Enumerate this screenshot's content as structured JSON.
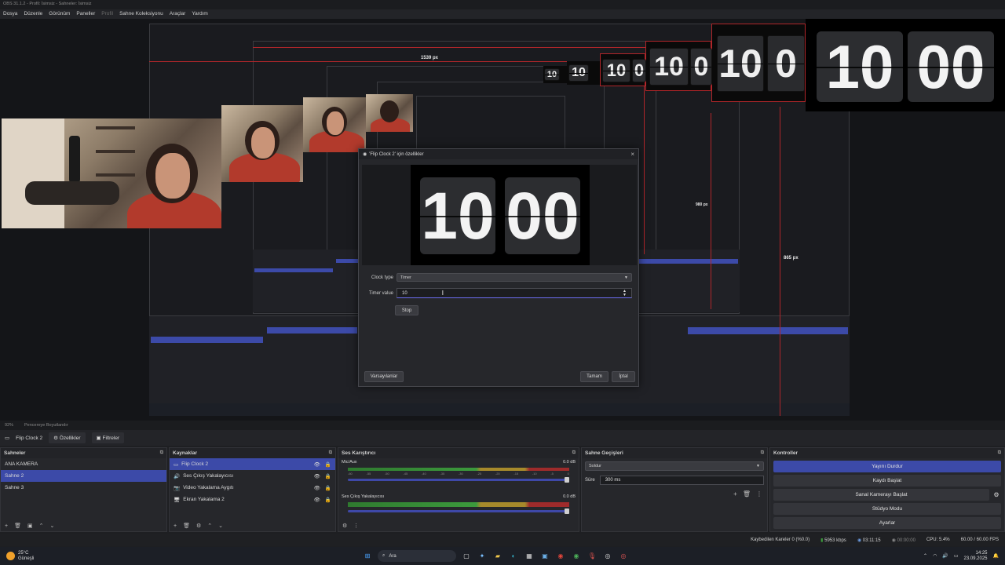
{
  "window": {
    "title": "OBS 31.1.2 - Profil: İsimsiz - Sahneler: İsimsiz"
  },
  "menu": {
    "items": [
      "Dosya",
      "Düzenle",
      "Görünüm",
      "Paneller",
      "Profil",
      "Sahne Koleksiyonu",
      "Araçlar",
      "Yardım"
    ]
  },
  "canvas": {
    "clock_big": [
      "10",
      "00"
    ],
    "measure_top": "1539 px",
    "measure_mid": "980 px",
    "measure_right": "865 px"
  },
  "dialog": {
    "title": "'Flip Clock 2' için özellikler",
    "preview_digits": [
      "10",
      "00"
    ],
    "clock_type_label": "Clock type",
    "clock_type_value": "Timer",
    "timer_value_label": "Timer value",
    "timer_value": "10",
    "stop_label": "Stop",
    "defaults_label": "Varsayılanlar",
    "ok_label": "Tamam",
    "cancel_label": "İptal"
  },
  "status_line": {
    "zoom": "92%",
    "fit": "Pencereye Boyutlandır"
  },
  "source_toolbar": {
    "source_name": "Flip Clock 2",
    "properties": "Özellikler",
    "filters": "Filtreler"
  },
  "scenes": {
    "title": "Sahneler",
    "items": [
      "ANA KAMERA",
      "Sahne 2",
      "Sahne 3"
    ],
    "selected": 1
  },
  "sources": {
    "title": "Kaynaklar",
    "items": [
      "Flip Clock 2",
      "Ses Çıkış Yakalayıcısı",
      "Video Yakalama Aygıtı",
      "Ekran Yakalama 2"
    ],
    "selected": 0
  },
  "mixer": {
    "title": "Ses Karıştırıcı",
    "tracks": [
      {
        "name": "Mic/Aux",
        "db": "0.0 dB"
      },
      {
        "name": "Ses Çıkış Yakalayıcısı",
        "db": "0.0 dB"
      }
    ],
    "scale": [
      "-60",
      "-55",
      "-50",
      "-45",
      "-40",
      "-35",
      "-30",
      "-25",
      "-20",
      "-15",
      "-10",
      "-5",
      "0"
    ]
  },
  "transitions": {
    "title": "Sahne Geçişleri",
    "type": "Soldur",
    "duration_label": "Süre",
    "duration": "300 ms"
  },
  "controls": {
    "title": "Kontroller",
    "items": [
      "Yayını Durdur",
      "Kaydı Başlat",
      "Sanal Kamerayı Başlat",
      "Stüdyo Modu",
      "Ayarlar"
    ]
  },
  "stats": {
    "dropped": "Kaybedilen Kareler 0 (%0.0)",
    "bitrate": "5953 kbps",
    "stream_time": "03:11:15",
    "rec_time": "00:00:00",
    "cpu": "CPU: 5.4%",
    "fps": "60.00 / 60.00 FPS"
  },
  "taskbar": {
    "weather_temp": "25°C",
    "weather_desc": "Güneşli",
    "search": "Ara",
    "time": "14:25",
    "date": "23.09.2025"
  }
}
